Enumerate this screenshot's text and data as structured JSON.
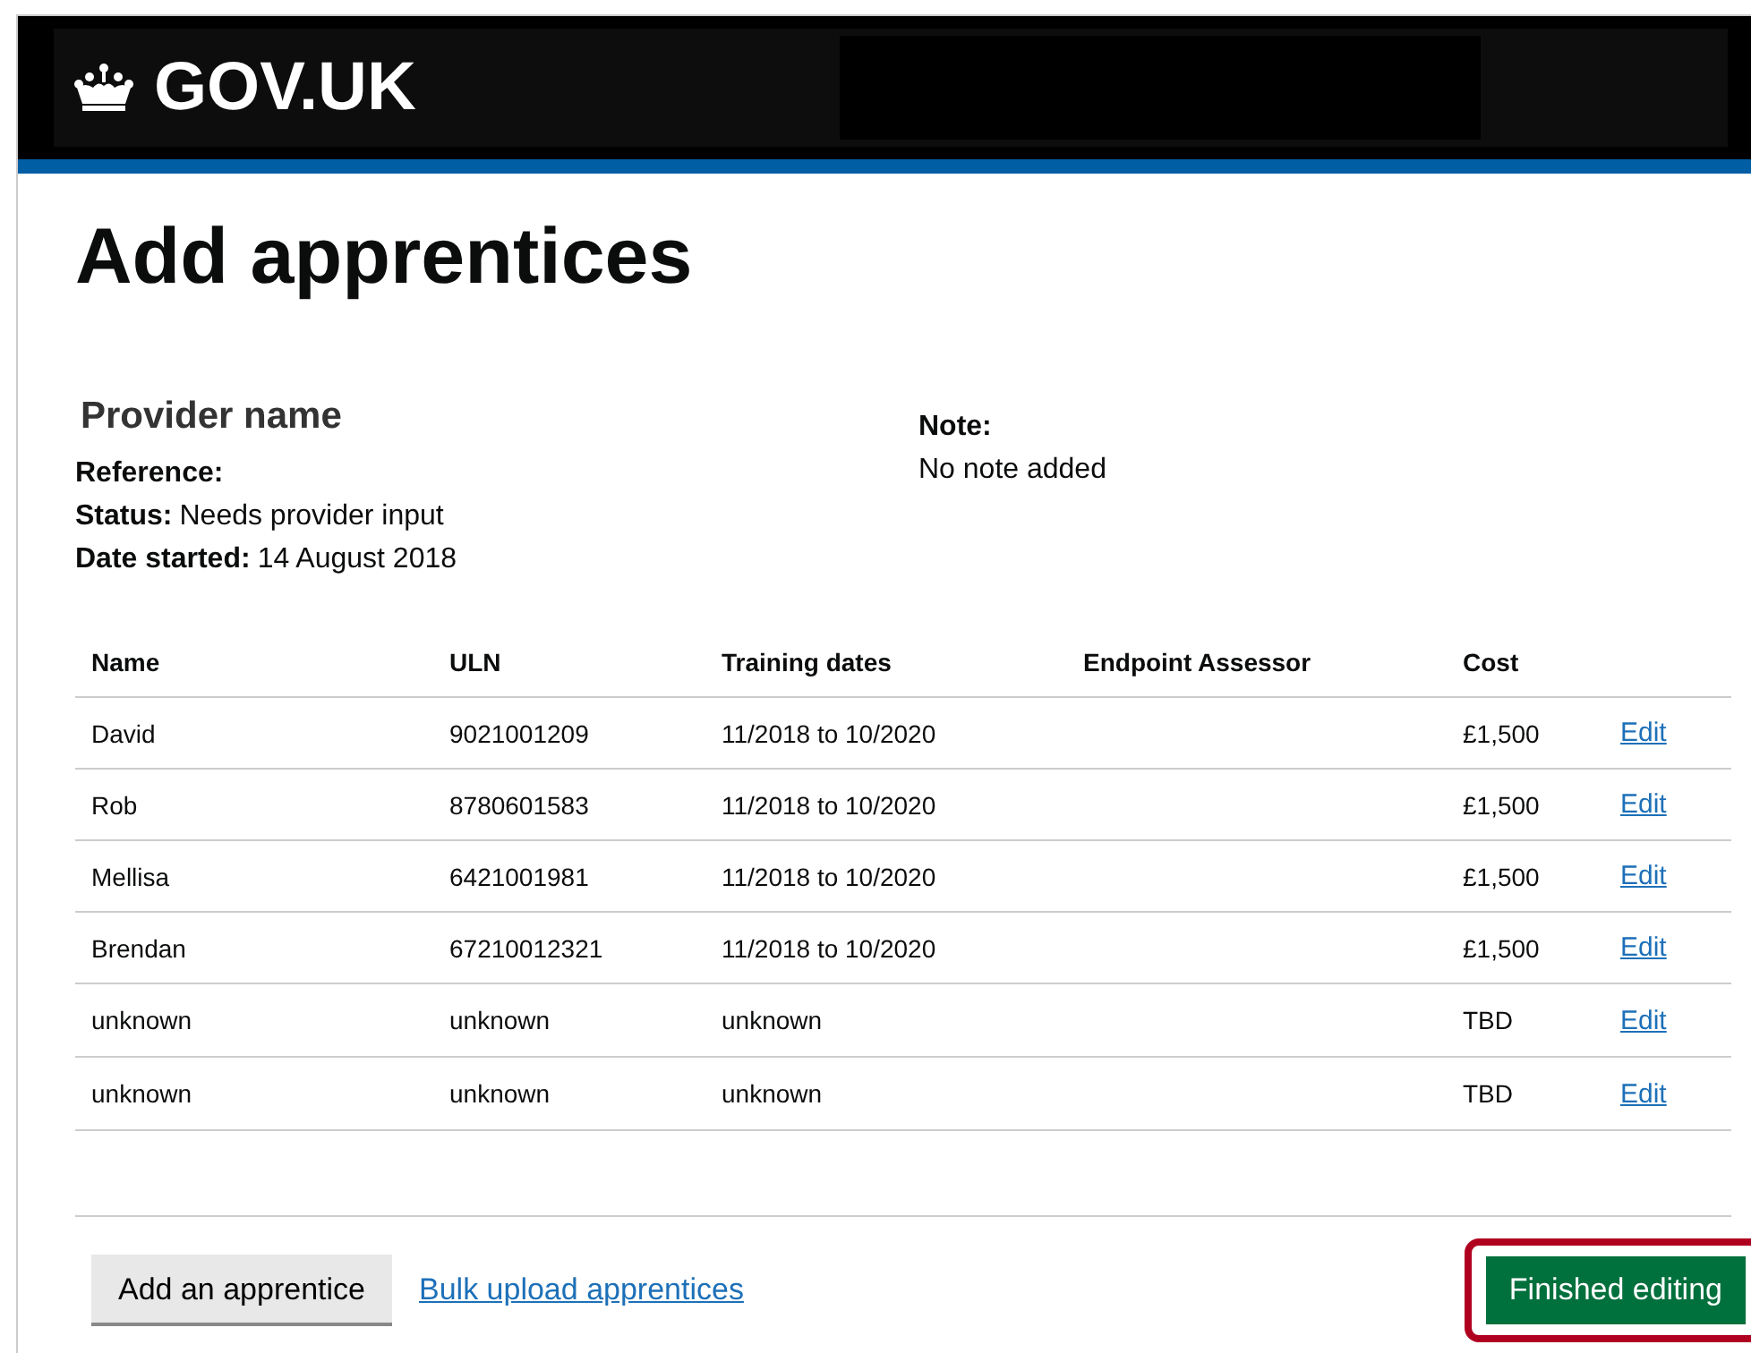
{
  "header": {
    "logo_text": "GOV.UK"
  },
  "page_title": "Add apprentices",
  "provider": {
    "heading": "Provider name",
    "reference_label": "Reference:",
    "status_label": "Status:",
    "status_value": "Needs provider input",
    "date_label": "Date started:",
    "date_value": "14 August 2018"
  },
  "note": {
    "label": "Note:",
    "value": "No note added"
  },
  "table": {
    "columns": [
      "Name",
      "ULN",
      "Training dates",
      "Endpoint Assessor",
      "Cost",
      ""
    ],
    "rows": [
      {
        "name": "David",
        "uln": "9021001209",
        "training_dates": "11/2018 to 10/2020",
        "cost": "£1,500",
        "action": "Edit"
      },
      {
        "name": "Rob",
        "uln": "8780601583",
        "training_dates": "11/2018 to 10/2020",
        "cost": "£1,500",
        "action": "Edit"
      },
      {
        "name": "Mellisa",
        "uln": "6421001981",
        "training_dates": "11/2018 to 10/2020",
        "cost": "£1,500",
        "action": "Edit"
      },
      {
        "name": "Brendan",
        "uln": "67210012321",
        "training_dates": "11/2018 to 10/2020",
        "cost": "£1,500",
        "action": "Edit"
      },
      {
        "name": "unknown",
        "uln": "unknown",
        "training_dates": "unknown",
        "cost": "TBD",
        "action": "Edit"
      },
      {
        "name": "unknown",
        "uln": "unknown",
        "training_dates": "unknown",
        "cost": "TBD",
        "action": "Edit"
      }
    ]
  },
  "actions": {
    "add_button": "Add an apprentice",
    "bulk_link": "Bulk upload apprentices",
    "finish_button": "Finished editing",
    "finish_highlighted": true
  }
}
